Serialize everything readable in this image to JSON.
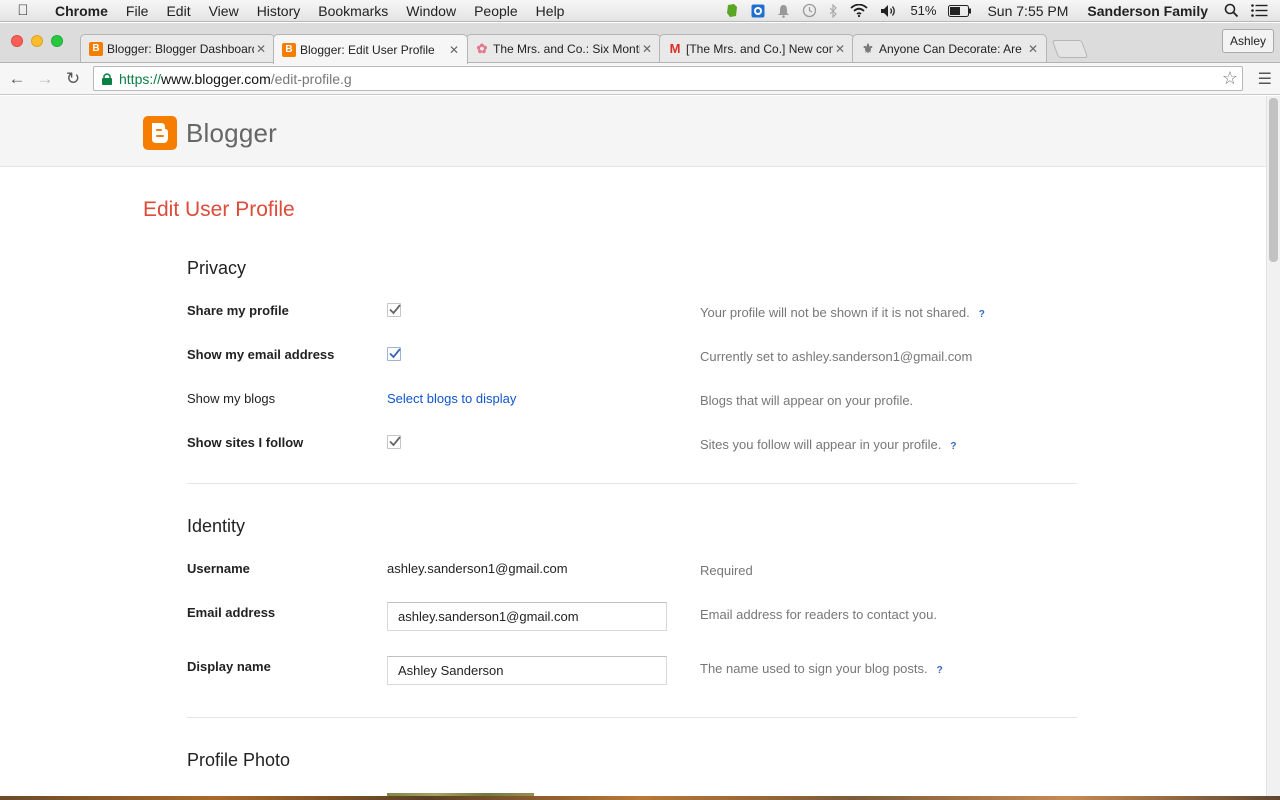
{
  "menubar": {
    "app_name": "Chrome",
    "items": [
      "File",
      "Edit",
      "View",
      "History",
      "Bookmarks",
      "Window",
      "People",
      "Help"
    ],
    "battery": "51%",
    "clock": "Sun 7:55 PM",
    "user": "Sanderson Family"
  },
  "browser": {
    "tabs": [
      {
        "title": "Blogger: Blogger Dashboard",
        "favicon": "blogger-icon"
      },
      {
        "title": "Blogger: Edit User Profile",
        "favicon": "blogger-icon"
      },
      {
        "title": "The Mrs. and Co.: Six Months",
        "favicon": "flower-icon"
      },
      {
        "title": "[The Mrs. and Co.] New comment",
        "favicon": "gmail-icon"
      },
      {
        "title": "Anyone Can Decorate: Are",
        "favicon": "fleur-de-lis-icon"
      }
    ],
    "active_tab_index": 1,
    "profile_name": "Ashley",
    "url_scheme": "https://",
    "url_host": "www.blogger.com",
    "url_path": "/edit-profile.g"
  },
  "page": {
    "logo_text": "Blogger",
    "title": "Edit User Profile",
    "privacy": {
      "heading": "Privacy",
      "share_profile": {
        "label": "Share my profile",
        "checked": true,
        "help": "Your profile will not be shown if it is not shared.",
        "help_link": "?"
      },
      "show_email": {
        "label": "Show my email address",
        "checked": true,
        "help": "Currently set to ashley.sanderson1@gmail.com"
      },
      "show_blogs": {
        "label": "Show my blogs",
        "link": "Select blogs to display",
        "help": "Blogs that will appear on your profile."
      },
      "show_sites": {
        "label": "Show sites I follow",
        "checked": true,
        "help": "Sites you follow will appear in your profile.",
        "help_link": "?"
      }
    },
    "identity": {
      "heading": "Identity",
      "username": {
        "label": "Username",
        "value": "ashley.sanderson1@gmail.com",
        "help": "Required"
      },
      "email": {
        "label": "Email address",
        "value": "ashley.sanderson1@gmail.com",
        "help": "Email address for readers to contact you."
      },
      "display_name": {
        "label": "Display name",
        "value": "Ashley Sanderson",
        "help": "The name used to sign your blog posts.",
        "help_link": "?"
      }
    },
    "profile_photo": {
      "heading": "Profile Photo"
    }
  },
  "colors": {
    "title_accent": "#dd4b39",
    "link": "#1155cc",
    "blogger_orange": "#f57d00",
    "secure_green": "#0b8043"
  }
}
